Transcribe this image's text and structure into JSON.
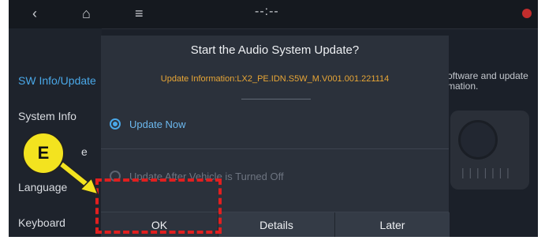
{
  "topbar": {
    "back_icon": "chevron-left-icon",
    "home_icon": "home-icon",
    "menu_icon": "menu-icon",
    "clock": "--:--",
    "notification_icon": "notification-icon"
  },
  "sidebar": {
    "search_icon": "search-icon",
    "items": [
      {
        "label": "SW Info/Update"
      },
      {
        "label": "System Info"
      },
      {
        "label": "e"
      },
      {
        "label": "Language"
      },
      {
        "label": "Keyboard"
      }
    ]
  },
  "background": {
    "text_line1": "oftware and update",
    "text_line2": "mation."
  },
  "dialog": {
    "title": "Start the Audio System Update?",
    "info": "Update Information:LX2_PE.IDN.S5W_M.V001.001.221114",
    "options": [
      {
        "label": "Update Now",
        "selected": true
      },
      {
        "label": "Update After Vehicle is Turned Off",
        "selected": false
      }
    ],
    "buttons": {
      "ok": "OK",
      "details": "Details",
      "later": "Later"
    }
  },
  "annotation": {
    "callout_label": "E",
    "highlight_color": "#e11f1f",
    "callout_color": "#f3e31f"
  }
}
